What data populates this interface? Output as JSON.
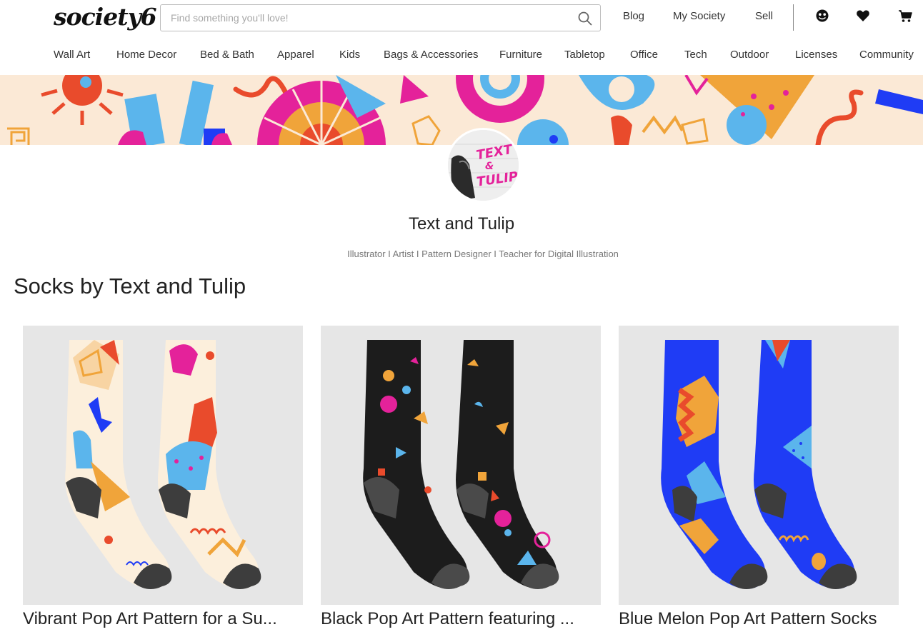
{
  "header": {
    "logo": "society6",
    "search_placeholder": "Find something you'll love!",
    "links": [
      "Blog",
      "My Society",
      "Sell"
    ],
    "icons": [
      "profile-icon",
      "heart-icon",
      "cart-icon"
    ]
  },
  "nav": {
    "categories": [
      "Wall Art",
      "Home Decor",
      "Bed & Bath",
      "Apparel",
      "Kids",
      "Bags & Accessories",
      "Furniture",
      "Tabletop",
      "Office",
      "Tech",
      "Outdoor",
      "Licenses",
      "Community"
    ]
  },
  "artist": {
    "name": "Text and Tulip",
    "bio": "Illustrator I Artist I Pattern Designer I Teacher for Digital Illustration",
    "avatar_text": "TEXT & TULIP"
  },
  "section": {
    "title": "Socks by Text and Tulip"
  },
  "products": [
    {
      "title": "Vibrant Pop Art Pattern for a Su..."
    },
    {
      "title": "Black Pop Art Pattern featuring ..."
    },
    {
      "title": "Blue Melon Pop Art Pattern Socks"
    }
  ],
  "colors": {
    "banner_bg": "#fbe9d6",
    "magenta": "#e4229a",
    "orange": "#f0a43a",
    "red": "#e94b2c",
    "blue": "#1f3cf5",
    "light_blue": "#5bb5ec",
    "cream": "#fcefdc",
    "black_sock": "#1c1c1c",
    "heel": "#4a4a4a"
  }
}
